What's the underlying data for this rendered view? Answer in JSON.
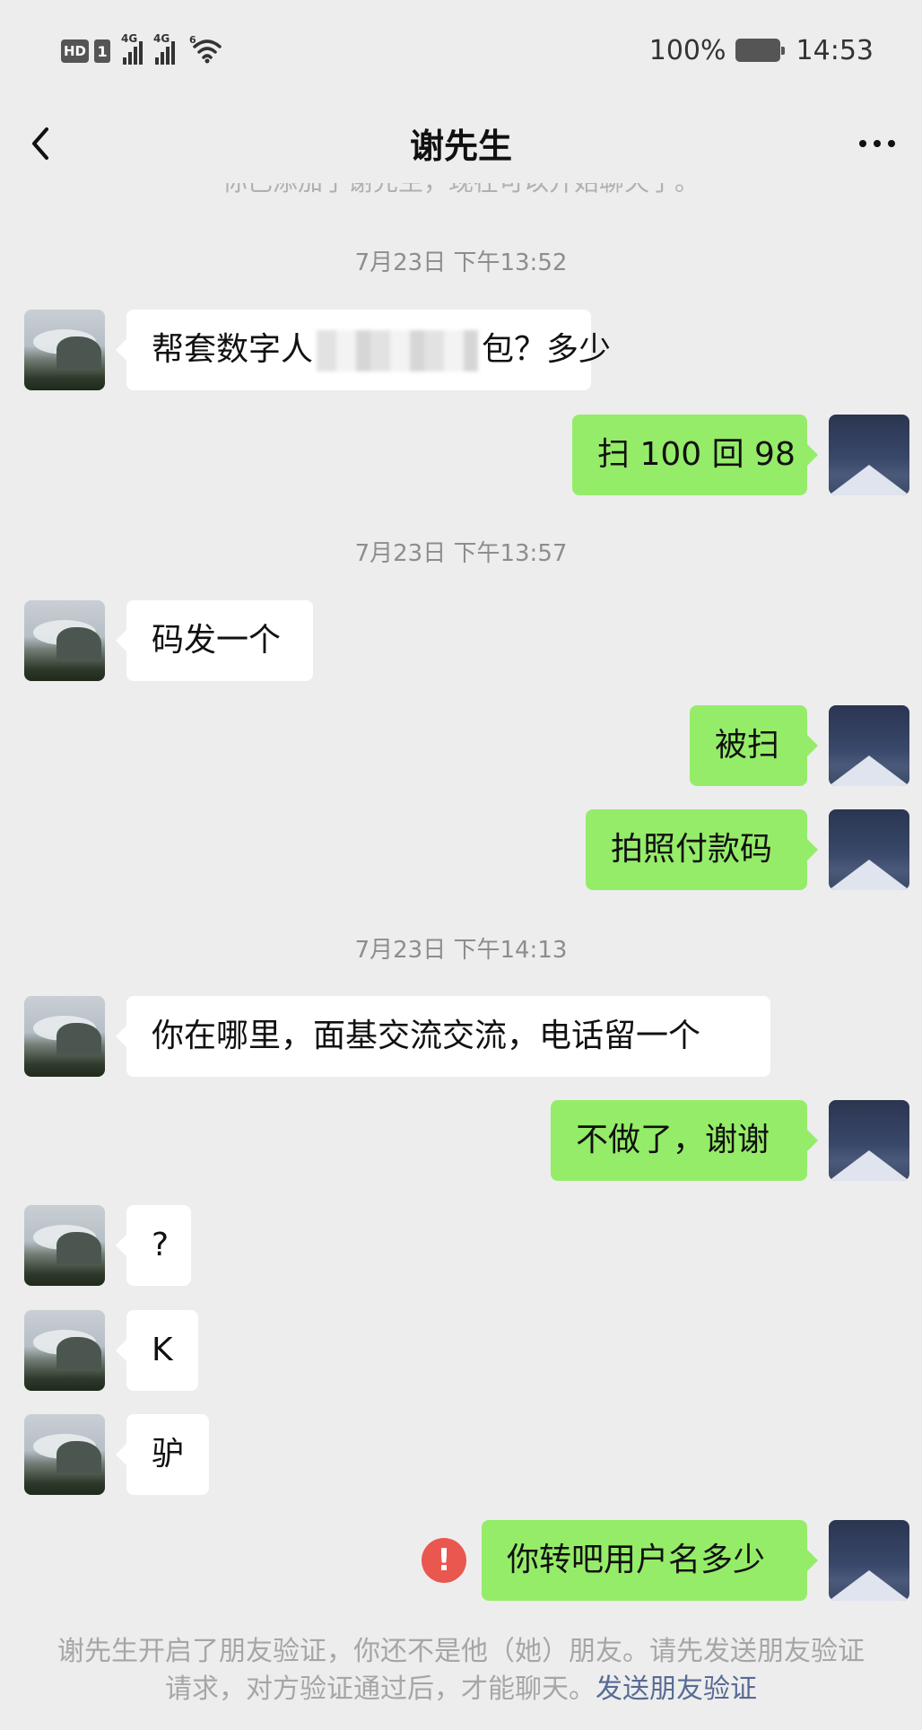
{
  "status_bar": {
    "hd_badge": "HD",
    "sim_number": "1",
    "signal1_label": "4G",
    "signal2_label": "4G",
    "wifi_label": "6",
    "battery_percent": "100%",
    "time": "14:53"
  },
  "header": {
    "title": "谢先生"
  },
  "cutoff_system_text": "你已添加了谢先生，现在可以开始聊天了。",
  "messages": {
    "ts1": "7月23日 下午13:52",
    "m1_a": "帮套数字人",
    "m1_b": "包？多少",
    "m2": "扫 100 回 98",
    "ts2": "7月23日 下午13:57",
    "m3": "码发一个",
    "m4": "被扫",
    "m5": "拍照付款码",
    "ts3": "7月23日 下午14:13",
    "m6": "你在哪里，面基交流交流，电话留一个",
    "m7": "不做了，谢谢",
    "m8": "?",
    "m9": "K",
    "m10": "驴",
    "m11": "你转吧用户名多少"
  },
  "send_failed_mark": "!",
  "notice": {
    "text": "谢先生开启了朋友验证，你还不是他（她）朋友。请先发送朋友验证请求，对方验证通过后，才能聊天。",
    "link": "发送朋友验证"
  },
  "icons": [
    "back-arrow-icon",
    "more-icon",
    "wifi-icon",
    "battery-icon",
    "error-icon"
  ],
  "colors": {
    "background": "#ededed",
    "incoming_bubble": "#ffffff",
    "outgoing_bubble": "#95ec69",
    "link": "#576b95",
    "error": "#e9574f"
  }
}
